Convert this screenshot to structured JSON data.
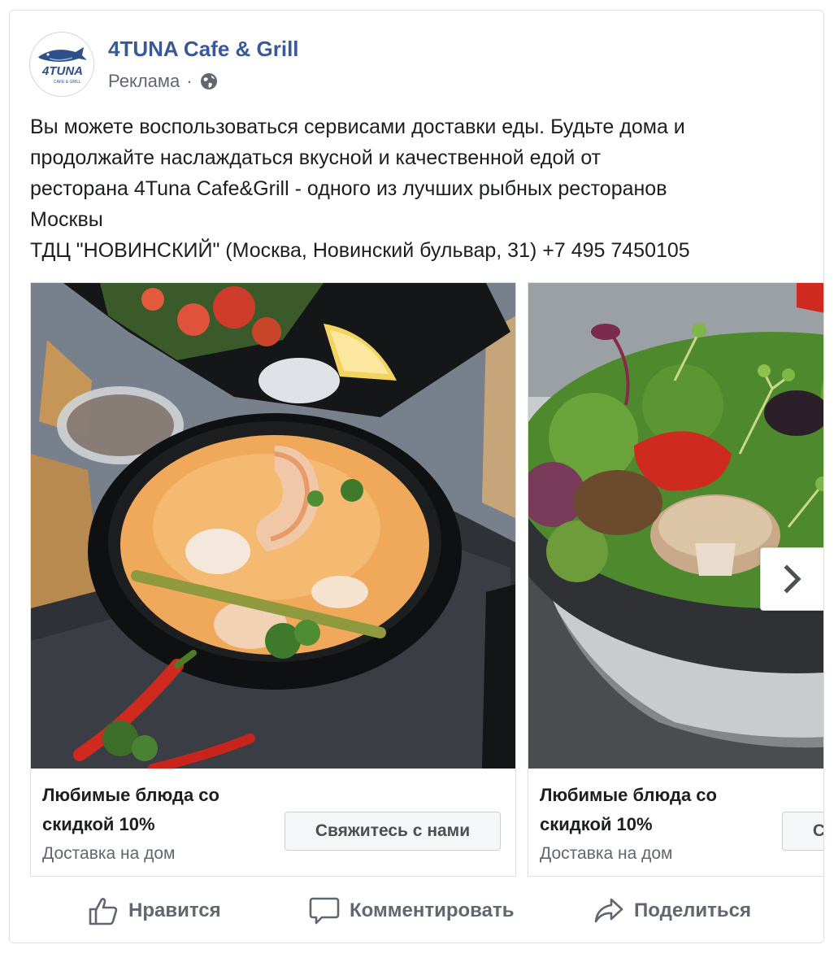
{
  "post": {
    "page_name": "4TUNA Cafe & Grill",
    "sponsored_label": "Реклама",
    "separator": "·",
    "privacy_icon": "globe-icon",
    "logo_text": "4TUNA",
    "logo_subtext": "CAFE & GRILL",
    "text_lines": [
      "Вы можете воспользоваться сервисами доставки еды. Будьте дома и",
      "продолжайте наслаждаться вкусной и качественной едой от",
      "ресторана 4Tuna Cafe&Grill - одного из лучших рыбных ресторанов",
      "Москвы",
      "ТДЦ \"НОВИНСКИЙ\" (Москва, Новинский бульвар, 31) +7 495 7450105"
    ]
  },
  "carousel": {
    "cards": [
      {
        "title_line1": "Любимые блюда со",
        "title_line2": "скидкой 10%",
        "subtitle": "Доставка на дом",
        "cta_label": "Свяжитесь с нами"
      },
      {
        "title_line1": "Любимые блюда со",
        "title_line2": "скидкой 10%",
        "subtitle": "Доставка на дом",
        "cta_label": "Свяжитесь с нами"
      }
    ],
    "next_icon": "chevron-right-icon"
  },
  "actions": {
    "like_label": "Нравится",
    "comment_label": "Комментировать",
    "share_label": "Поделиться"
  },
  "colors": {
    "page_name": "#385898",
    "secondary_text": "#606770",
    "border": "#dddfe2"
  }
}
